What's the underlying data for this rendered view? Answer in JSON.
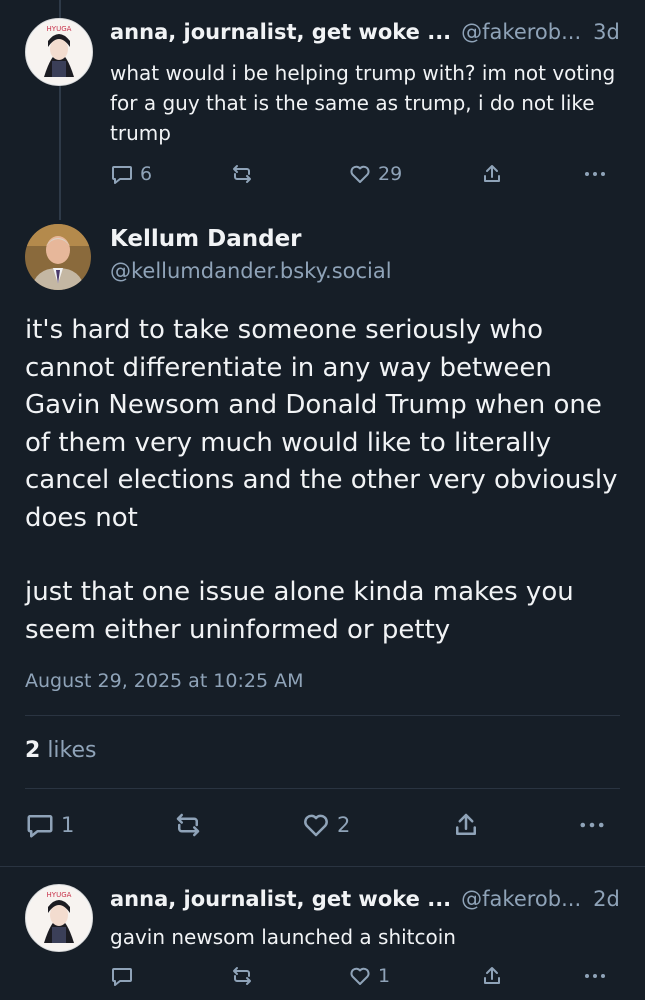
{
  "reply_top": {
    "author_name": "anna, journalist, get woke ...",
    "author_handle": "@fakerob...",
    "age": "3d",
    "text": "what would i be helping trump with? im not voting for a guy that is the same as trump, i do not like trump",
    "reply_count": "6",
    "repost_count": "",
    "like_count": "29"
  },
  "main_post": {
    "author_name": "Kellum Dander",
    "author_handle": "@kellumdander.bsky.social",
    "paragraph1": "it's hard to take someone seriously who cannot differentiate in any way between Gavin Newsom and Donald Trump when one of them very much would like to literally cancel elections and the other very obviously does not",
    "paragraph2": "just that one issue alone kinda makes you seem either uninformed or petty",
    "timestamp": "August 29, 2025 at 10:25 AM",
    "likes_count": "2",
    "likes_label": "likes",
    "reply_count": "1",
    "like_count": "2"
  },
  "reply_bottom": {
    "author_name": "anna, journalist, get woke ...",
    "author_handle": "@fakerob...",
    "age": "2d",
    "text": "gavin newsom launched a shitcoin",
    "like_count": "1"
  },
  "colors": {
    "background": "#161e27",
    "text": "#f1f3f5",
    "muted": "#8fa3b8",
    "divider": "#2a3441"
  }
}
